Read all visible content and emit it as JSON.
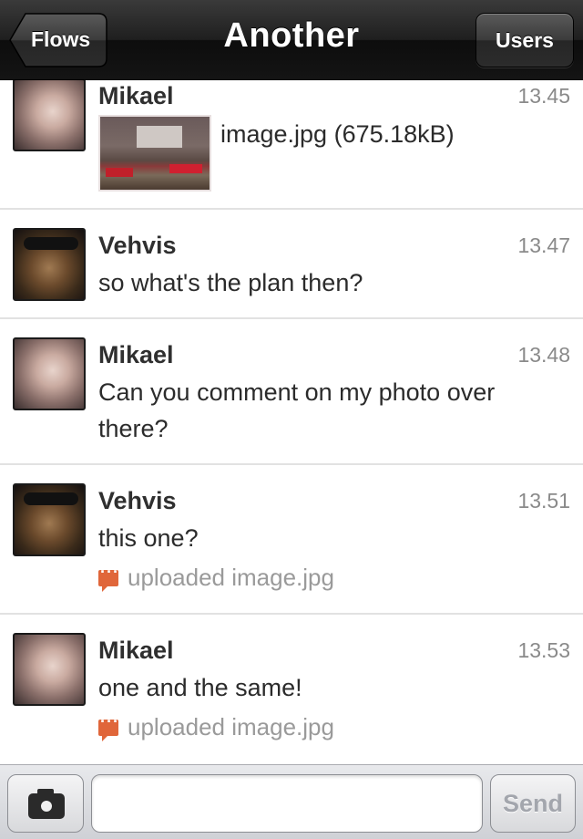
{
  "nav": {
    "title": "Another",
    "back_label": "Flows",
    "users_label": "Users"
  },
  "messages": [
    {
      "sender": "Mikael",
      "time": "13.45",
      "attachment": {
        "filename_label": "image.jpg (675.18kB)"
      },
      "avatar": "mikael"
    },
    {
      "sender": "Vehvis",
      "time": "13.47",
      "text": "so what's the plan then?",
      "avatar": "vehvis"
    },
    {
      "sender": "Mikael",
      "time": "13.48",
      "text": "Can you comment on my photo over there?",
      "avatar": "mikael"
    },
    {
      "sender": "Vehvis",
      "time": "13.51",
      "text": "this one?",
      "upload_note": "uploaded image.jpg",
      "avatar": "vehvis"
    },
    {
      "sender": "Mikael",
      "time": "13.53",
      "text": "one and the same!",
      "upload_note": "uploaded image.jpg",
      "avatar": "mikael"
    }
  ],
  "toolbar": {
    "camera_icon": "camera-icon",
    "input_value": "",
    "input_placeholder": "",
    "send_label": "Send"
  },
  "colors": {
    "navbar": "#1f1f1f",
    "upload_icon": "#e0663a",
    "send_disabled": "#a3a6ad"
  }
}
